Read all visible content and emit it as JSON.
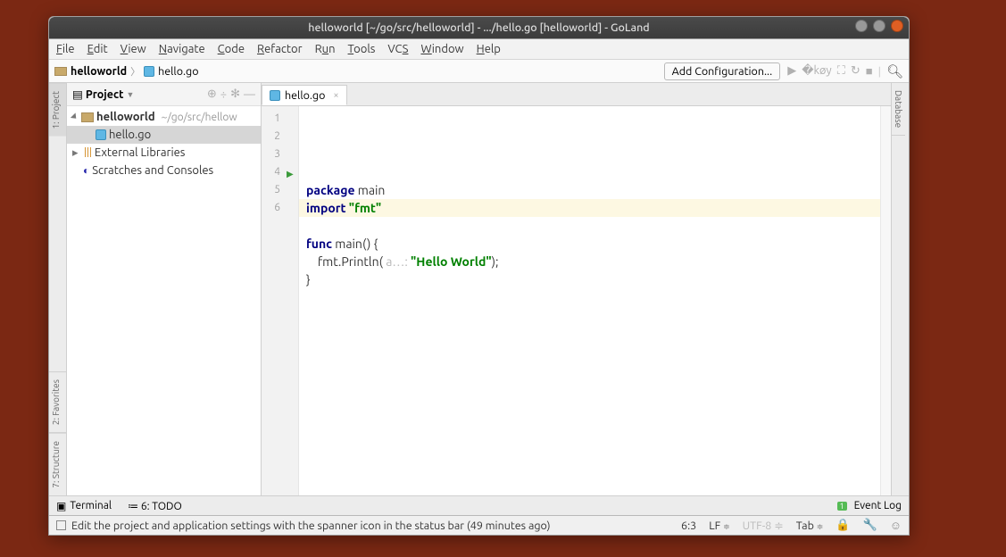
{
  "title": "helloworld [~/go/src/helloworld] - .../hello.go [helloworld] - GoLand",
  "menu": {
    "items": [
      "File",
      "Edit",
      "View",
      "Navigate",
      "Code",
      "Refactor",
      "Run",
      "Tools",
      "VCS",
      "Window",
      "Help"
    ]
  },
  "breadcrumb": {
    "project": "helloworld",
    "file": "hello.go"
  },
  "run": {
    "addConfig": "Add Configuration..."
  },
  "leftTabs": {
    "project": "1: Project",
    "favorites": "2: Favorites",
    "structure": "7: Structure"
  },
  "rightTabs": {
    "database": "Database"
  },
  "sidebar": {
    "title": "Project",
    "root": {
      "name": "helloworld",
      "path": "~/go/src/hellow"
    },
    "file": "hello.go",
    "libs": "External Libraries",
    "scratch": "Scratches and Consoles"
  },
  "editorTab": {
    "name": "hello.go"
  },
  "gutter": {
    "l1": "1",
    "l2": "2",
    "l3": "3",
    "l4": "4",
    "l5": "5",
    "l6": "6"
  },
  "code": {
    "package_kw": "package",
    "package_name": "main",
    "import_kw": "import",
    "import_val": "\"fmt\"",
    "func_kw": "func",
    "func_name": "main",
    "func_sig": "() {",
    "indent": "    ",
    "call": "fmt.Println(",
    "hint": " a…: ",
    "lit": "\"Hello World\"",
    "callEnd": ");",
    "close": "}"
  },
  "bottom": {
    "terminal": "Terminal",
    "todo": "6: TODO",
    "eventLog": "Event Log",
    "badge": "1"
  },
  "status": {
    "msg": "Edit the project and application settings with the spanner icon in the status bar (49 minutes ago)",
    "pos": "6:3",
    "sep": "LF",
    "enc": "UTF-8",
    "indent": "Tab"
  }
}
